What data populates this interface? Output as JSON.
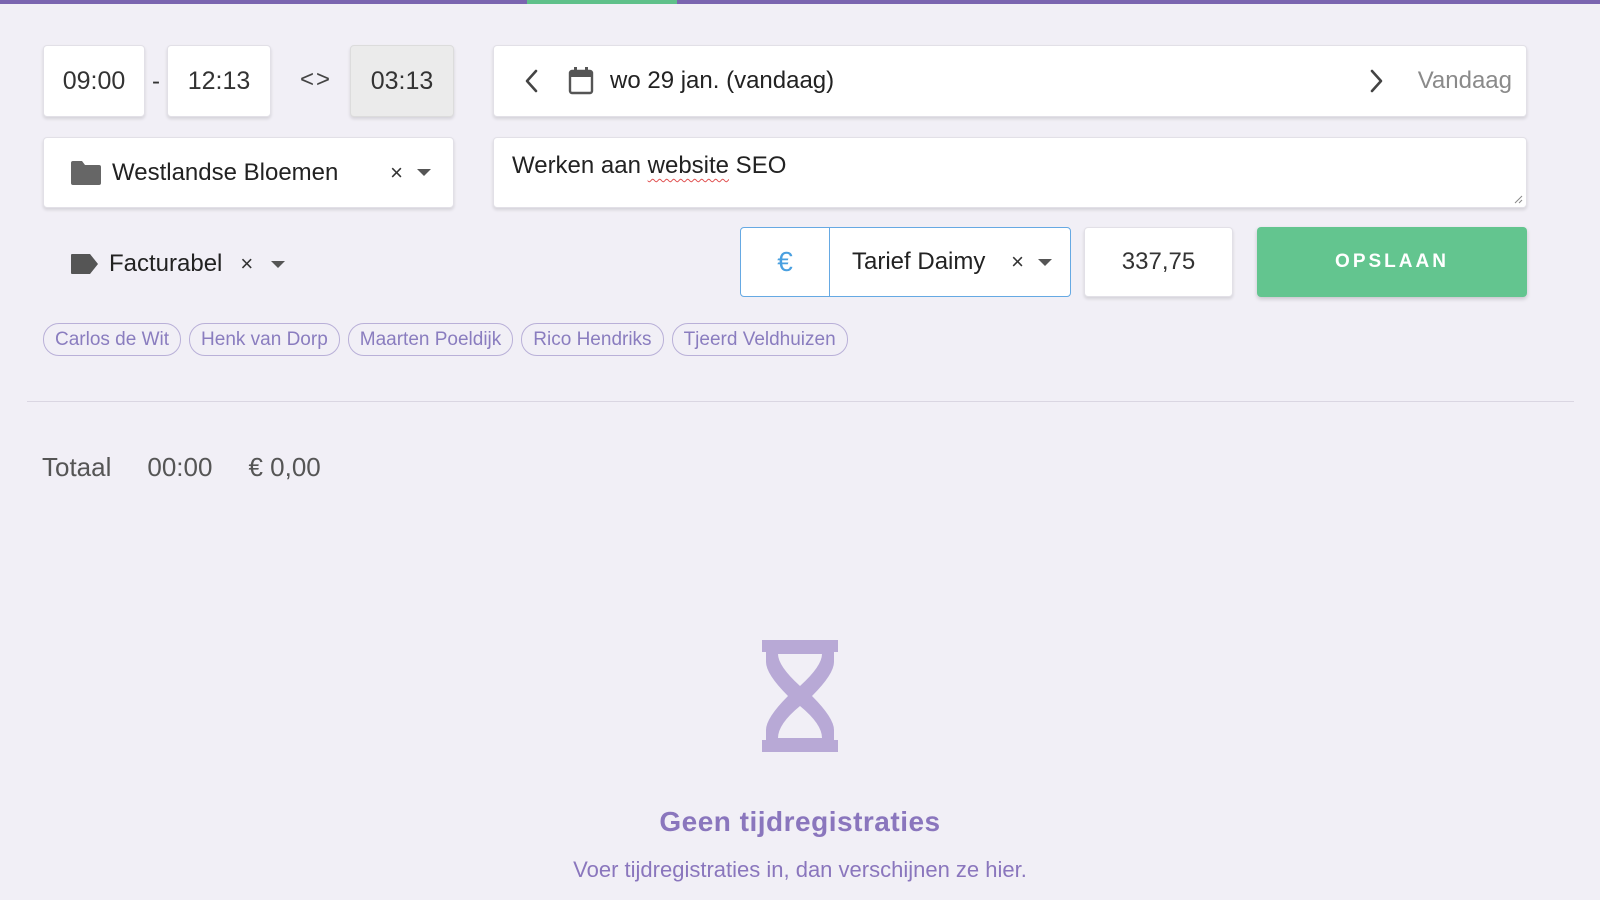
{
  "timer": {
    "start": "09:00",
    "separator": "-",
    "end": "12:13",
    "swap_glyph": "<>",
    "duration": "03:13"
  },
  "date": {
    "label": "wo 29 jan. (vandaag)",
    "today_button": "Vandaag"
  },
  "project": {
    "name": "Westlandse Bloemen",
    "clear": "×"
  },
  "description": {
    "before": "Werken aan ",
    "misspelled": "website",
    "after": " SEO"
  },
  "tag": {
    "name": "Facturabel",
    "clear": "×"
  },
  "rate": {
    "currency_symbol": "€",
    "name": "Tarief Daimy",
    "clear": "×",
    "amount": "337,75"
  },
  "save_label": "OPSLAAN",
  "people": [
    "Carlos de Wit",
    "Henk van Dorp",
    "Maarten Poeldijk",
    "Rico Hendriks",
    "Tjeerd Veldhuizen"
  ],
  "totals": {
    "label": "Totaal",
    "time": "00:00",
    "amount": "€ 0,00"
  },
  "empty_state": {
    "icon": "hourglass-icon",
    "title": "Geen tijdregistraties",
    "subtitle": "Voer tijdregistraties in, dan verschijnen ze hier."
  },
  "colors": {
    "accent": "#7b65b0",
    "success": "#63c58f",
    "currency": "#4aa0e0",
    "chip_text": "#8a7dbf",
    "empty_text": "#8a76bd"
  }
}
